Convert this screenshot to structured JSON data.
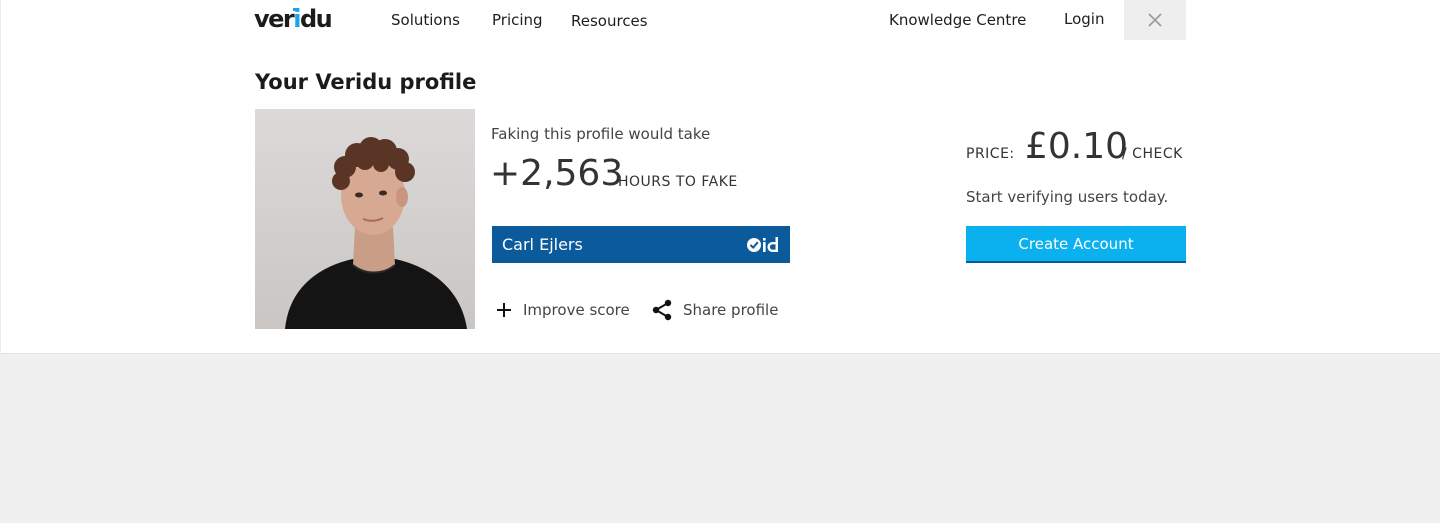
{
  "brand": {
    "logo_prefix": "ver",
    "logo_accent": "i",
    "logo_suffix": "du",
    "accent_color": "#1aa7e8",
    "primary_color": "#0a5a9c"
  },
  "nav": {
    "solutions": "Solutions",
    "pricing": "Pricing",
    "resources": "Resources",
    "knowledge_centre": "Knowledge Centre",
    "login": "Login",
    "close_icon": "close-icon"
  },
  "profile": {
    "title": "Your Veridu profile",
    "fake_caption": "Faking this profile would take",
    "hours_value": "+2,563",
    "hours_unit": "HOURS TO FAKE",
    "name": "Carl Ejlers",
    "badge_icon": "verified-id-icon",
    "actions": {
      "improve_score": "Improve score",
      "share_profile": "Share profile"
    }
  },
  "pricing": {
    "label": "PRICE:",
    "value": "£0.10",
    "unit": "/ CHECK",
    "tagline": "Start verifying users today.",
    "cta": "Create Account",
    "cta_color": "#0bb1ee"
  }
}
